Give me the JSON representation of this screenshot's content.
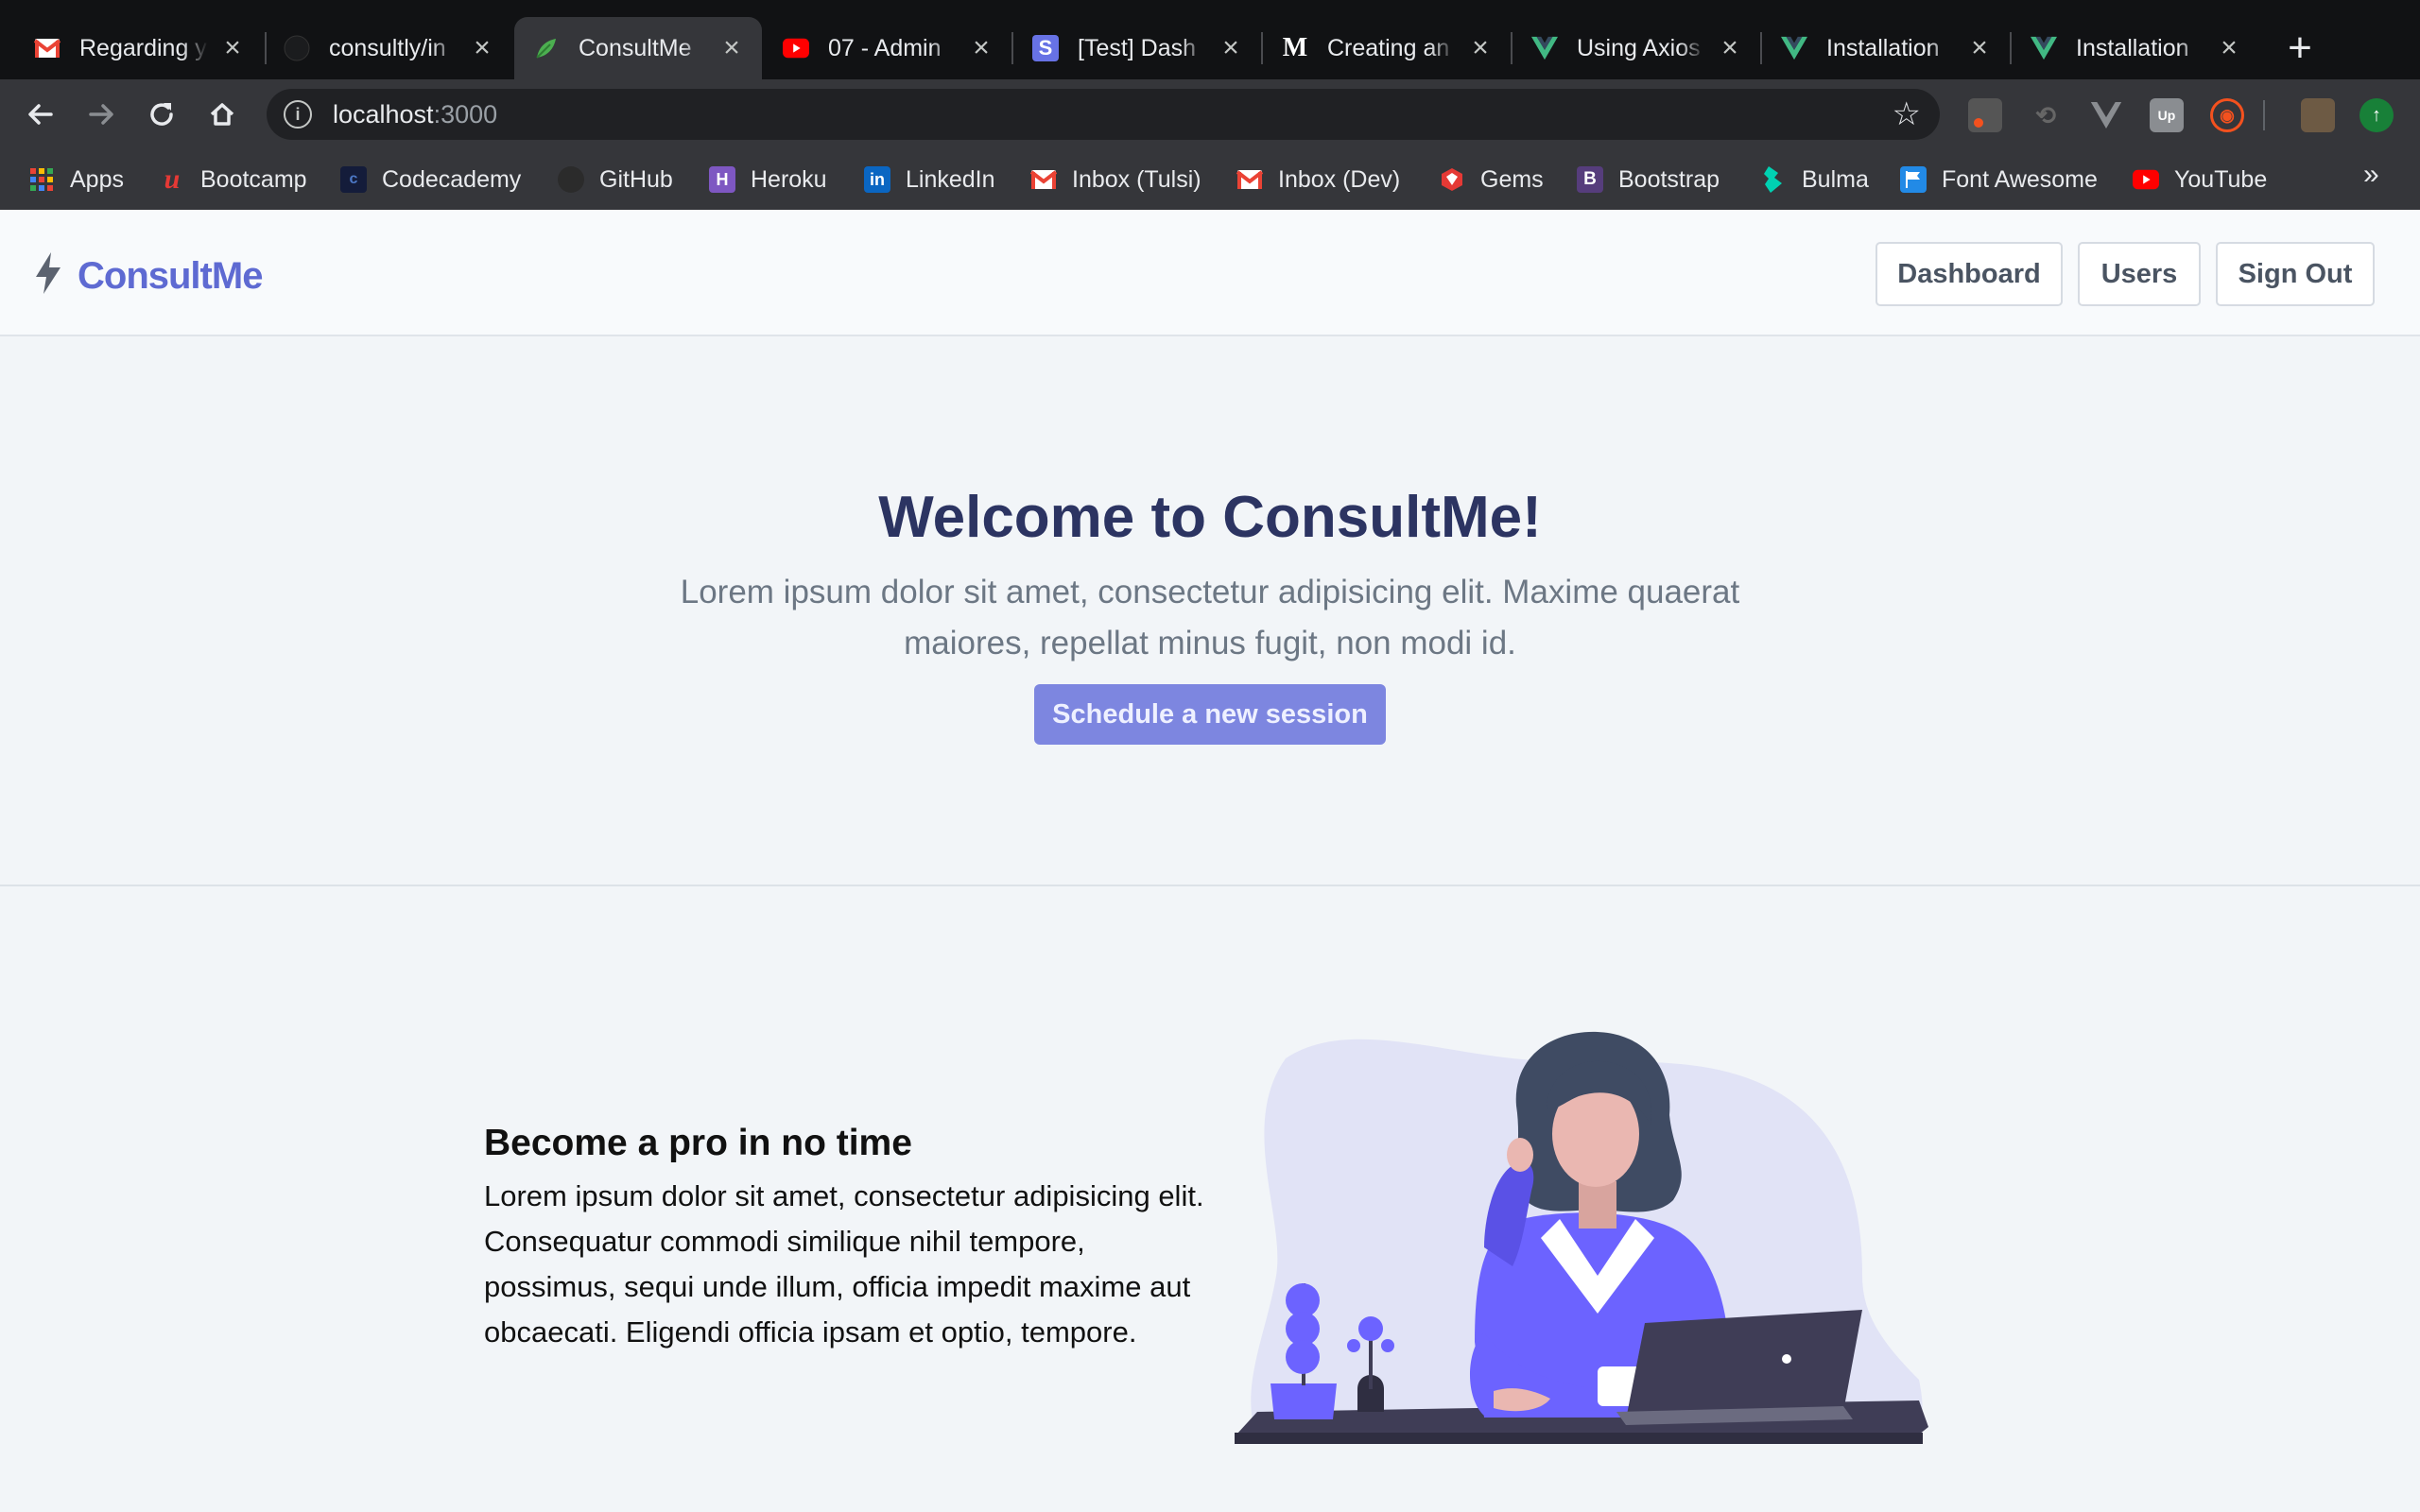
{
  "browser": {
    "tabs": [
      {
        "title": "Regarding y",
        "icon": "gmail-icon"
      },
      {
        "title": "consultly/in",
        "icon": "github-icon"
      },
      {
        "title": "ConsultMe",
        "icon": "leaf-icon",
        "active": true
      },
      {
        "title": "07 - Admin",
        "icon": "youtube-icon"
      },
      {
        "title": "[Test] Dash",
        "icon": "stripe-icon"
      },
      {
        "title": "Creating an",
        "icon": "medium-icon"
      },
      {
        "title": "Using Axios",
        "icon": "vue-icon"
      },
      {
        "title": "Installation",
        "icon": "vue-icon"
      },
      {
        "title": "Installation",
        "icon": "vue-icon"
      }
    ],
    "address": {
      "host": "localhost",
      "port": ":3000"
    },
    "bookmarks": [
      {
        "label": "Apps",
        "icon": "apps-grid-icon"
      },
      {
        "label": "Bootcamp",
        "icon": "bootcamp-icon"
      },
      {
        "label": "Codecademy",
        "icon": "codecademy-icon"
      },
      {
        "label": "GitHub",
        "icon": "github-icon"
      },
      {
        "label": "Heroku",
        "icon": "heroku-icon"
      },
      {
        "label": "LinkedIn",
        "icon": "linkedin-icon"
      },
      {
        "label": "Inbox (Tulsi)",
        "icon": "gmail-icon"
      },
      {
        "label": "Inbox (Dev)",
        "icon": "gmail-icon"
      },
      {
        "label": "Gems",
        "icon": "ruby-gems-icon"
      },
      {
        "label": "Bootstrap",
        "icon": "bootstrap-icon"
      },
      {
        "label": "Bulma",
        "icon": "bulma-icon"
      },
      {
        "label": "Font Awesome",
        "icon": "font-awesome-flag-icon"
      },
      {
        "label": "YouTube",
        "icon": "youtube-icon"
      }
    ],
    "more_bookmarks": "»"
  },
  "navbar": {
    "brand": "ConsultMe",
    "links": [
      "Dashboard",
      "Users",
      "Sign Out"
    ]
  },
  "hero": {
    "title": "Welcome to ConsultMe!",
    "subtitle": "Lorem ipsum dolor sit amet, consectetur adipisicing elit. Maxime quaerat maiores, repellat minus fugit, non modi id.",
    "cta": "Schedule a new session"
  },
  "feature": {
    "title": "Become a pro in no time",
    "text": "Lorem ipsum dolor sit amet, consectetur adipisicing elit. Consequatur commodi similique nihil tempore, possimus, sequi unde illum, officia impedit maxime aut obcaecati. Eligendi officia ipsam et optio, tempore."
  },
  "colors": {
    "brand": "#5e6ad2",
    "cta": "#7d86e0",
    "hero_title": "#2c3462",
    "page_bg": "#f2f5f8"
  }
}
